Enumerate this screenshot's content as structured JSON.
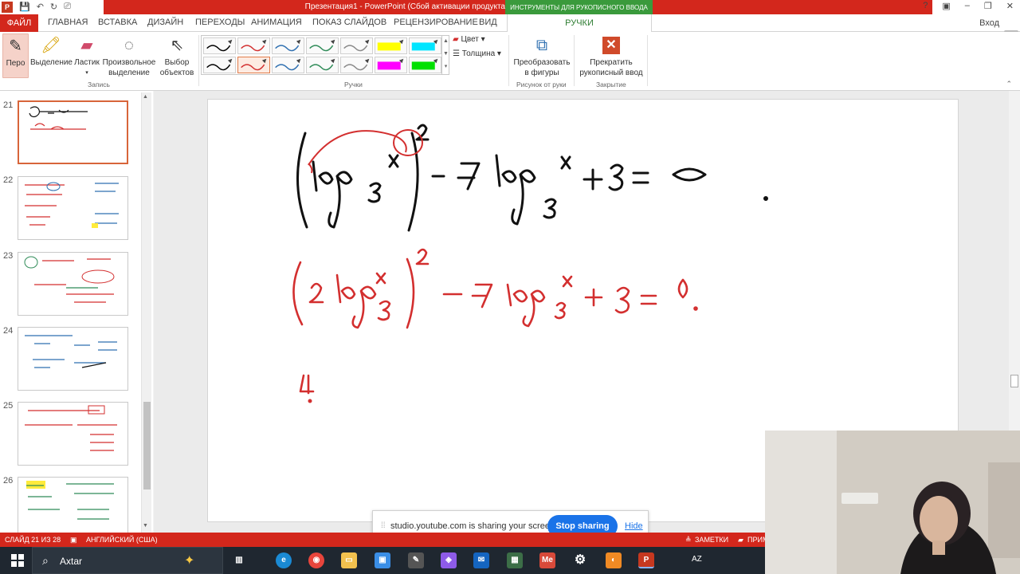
{
  "window": {
    "title": "Презентация1 - PowerPoint (Сбой активации продукта)",
    "context_tab_title": "ИНСТРУМЕНТЫ ДЛЯ РУКОПИСНОГО ВВОДА",
    "sign_in": "Вход",
    "controls": [
      "?",
      "▣",
      "–",
      "❐",
      "✕"
    ]
  },
  "tabs": [
    {
      "label": "ФАЙЛ"
    },
    {
      "label": "ГЛАВНАЯ"
    },
    {
      "label": "ВСТАВКА"
    },
    {
      "label": "ДИЗАЙН"
    },
    {
      "label": "ПЕРЕХОДЫ"
    },
    {
      "label": "АНИМАЦИЯ"
    },
    {
      "label": "ПОКАЗ СЛАЙДОВ"
    },
    {
      "label": "РЕЦЕНЗИРОВАНИЕ"
    },
    {
      "label": "ВИД"
    },
    {
      "label": "РУЧКИ"
    }
  ],
  "ribbon": {
    "pen": "Перо",
    "highlighter": "Выделение",
    "eraser": "Ластик",
    "lasso": "Произвольное выделение",
    "select": "Выбор объектов",
    "group_record": "Запись",
    "group_pens": "Ручки",
    "color": "Цвет",
    "thickness": "Толщина",
    "convert": "Преобразовать в фигуры",
    "group_ink_art": "Рисунок от руки",
    "stop_ink": "Прекратить рукописный ввод",
    "group_close": "Закрытие",
    "pen_colors": [
      "#000000",
      "#d32f2f",
      "#2e6fb0",
      "#2e8b57",
      "#888888",
      "#ffff00",
      "#00e5ff",
      "#000000",
      "#d32f2f",
      "#2e6fb0",
      "#2e8b57",
      "#888888",
      "#ff00ff",
      "#00e000"
    ]
  },
  "thumbnails": [
    {
      "num": "21",
      "selected": true
    },
    {
      "num": "22",
      "selected": false
    },
    {
      "num": "23",
      "selected": false
    },
    {
      "num": "24",
      "selected": false
    },
    {
      "num": "25",
      "selected": false
    },
    {
      "num": "26",
      "selected": false
    }
  ],
  "slide": {
    "line1_color": "#111111",
    "line2_color": "#d32f2f"
  },
  "share_banner": {
    "message": "studio.youtube.com is sharing your screen.",
    "stop": "Stop sharing",
    "hide": "Hide"
  },
  "statusbar": {
    "slide_info": "СЛАЙД 21 ИЗ 28",
    "language": "АНГЛИЙСКИЙ (США)",
    "notes": "ЗАМЕТКИ",
    "comments": "ПРИМ"
  },
  "taskbar": {
    "search_text": "Axtar",
    "lang": "AZ"
  }
}
